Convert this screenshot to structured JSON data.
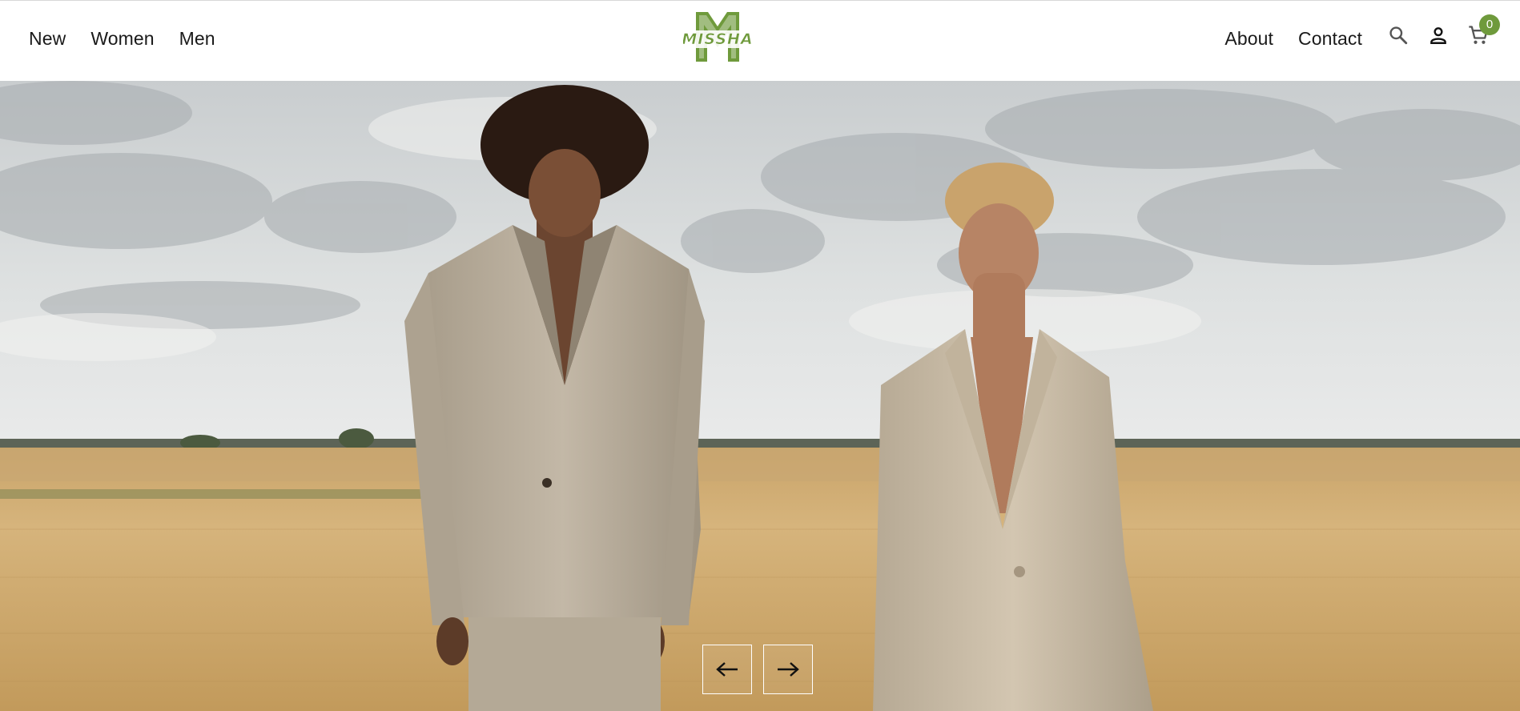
{
  "header": {
    "nav_left": [
      {
        "label": "New"
      },
      {
        "label": "Women"
      },
      {
        "label": "Men"
      }
    ],
    "nav_right": [
      {
        "label": "About"
      },
      {
        "label": "Contact"
      }
    ],
    "logo": {
      "text": "MISSHA",
      "letter": "M",
      "color": "#6f9a3c"
    },
    "icons": {
      "search": "search-icon",
      "account": "user-icon",
      "cart": "cart-icon"
    },
    "cart_count": "0",
    "badge_color": "#6f9a3c"
  },
  "hero": {
    "slider": {
      "prev_icon": "arrow-left-icon",
      "next_icon": "arrow-right-icon"
    }
  }
}
